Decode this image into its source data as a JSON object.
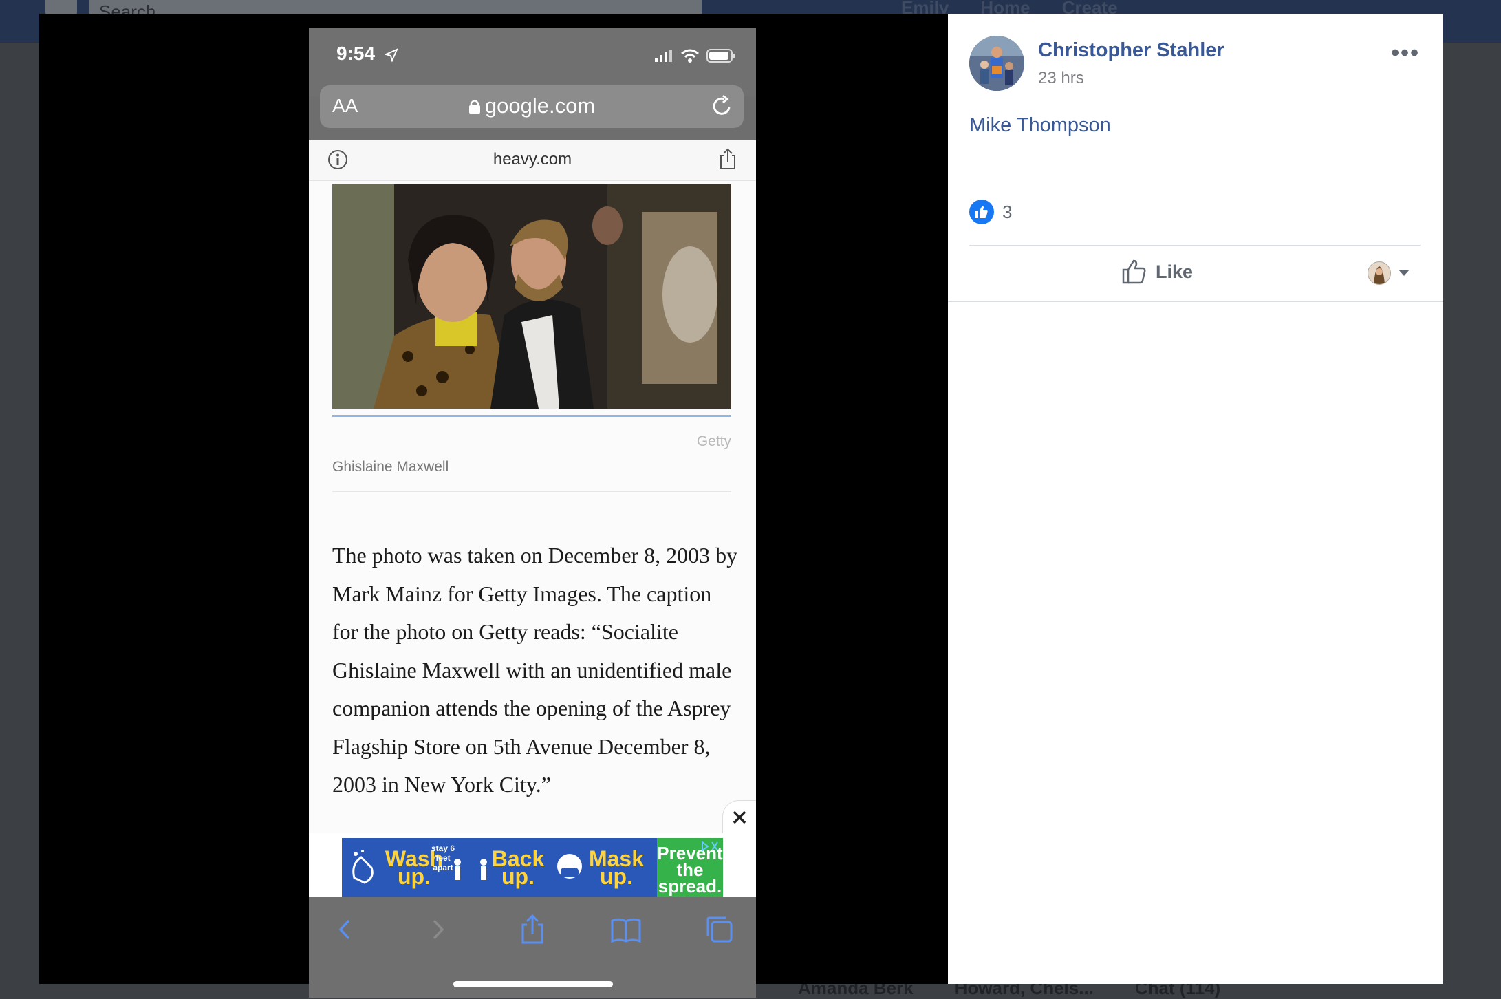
{
  "background": {
    "search_placeholder": "Search",
    "top_links": [
      "Emily",
      "Home",
      "Create"
    ],
    "bottom_bar": [
      "Amanda Berk",
      "Howard, Chels...",
      "Chat (114)"
    ]
  },
  "phone": {
    "status_time": "9:54",
    "url_aa": "AA",
    "url_domain": "google.com",
    "site_domain": "heavy.com",
    "photo_credit": "Getty",
    "photo_caption": "Ghislaine Maxwell",
    "article_text": "The photo was taken on December 8, 2003 by Mark Mainz for Getty Images. The caption for the photo on Getty reads: “Socialite Ghislaine Maxwell with an unidentified male companion attends the opening of the Asprey Flagship Store on 5th Avenue December 8, 2003 in New York City.”",
    "ad": {
      "wash": "Wash up.",
      "stay": "stay 6 feet apart",
      "back": "Back up.",
      "mask": "Mask up.",
      "prevent": "Prevent the spread."
    }
  },
  "post": {
    "poster_name": "Christopher Stahler",
    "time": "23 hrs",
    "more": "•••",
    "tagged": "Mike Thompson",
    "reaction_count": "3",
    "like_label": "Like"
  }
}
